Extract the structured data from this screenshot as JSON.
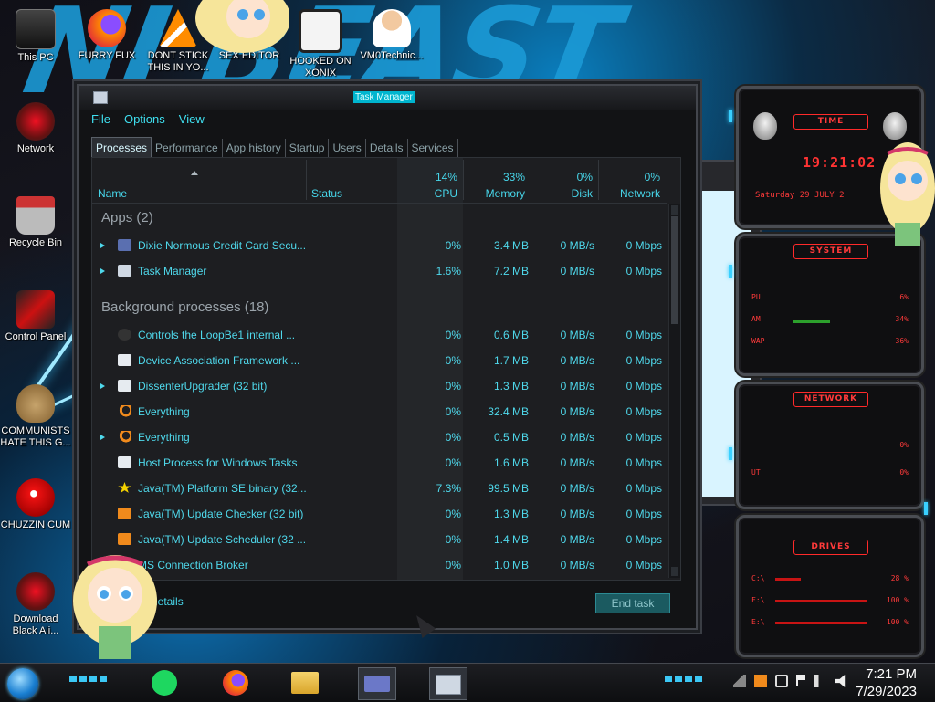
{
  "desktop_icons": [
    {
      "label": "This PC"
    },
    {
      "label": "FURRY FUX"
    },
    {
      "label": "DONT STICK THIS IN YO..."
    },
    {
      "label": "SEX EDITOR"
    },
    {
      "label": "HOOKED ON XONIX"
    },
    {
      "label": "VM0Technic..."
    },
    {
      "label": "Network"
    },
    {
      "label": "Recycle Bin"
    },
    {
      "label": "Control Panel"
    },
    {
      "label": "COMMUNISTS HATE THIS G..."
    },
    {
      "label": "CHUZZIN CUM"
    },
    {
      "label": "Download Black Ali..."
    }
  ],
  "task_manager": {
    "title": "Task Manager",
    "menu": [
      "File",
      "Options",
      "View"
    ],
    "tabs": [
      "Processes",
      "Performance",
      "App history",
      "Startup",
      "Users",
      "Details",
      "Services"
    ],
    "columns": {
      "name": "Name",
      "status": "Status",
      "cpu": {
        "pct": "14%",
        "label": "CPU"
      },
      "memory": {
        "pct": "33%",
        "label": "Memory"
      },
      "disk": {
        "pct": "0%",
        "label": "Disk"
      },
      "network": {
        "pct": "0%",
        "label": "Network"
      }
    },
    "groups": {
      "apps": "Apps (2)",
      "background": "Background processes (18)"
    },
    "apps": [
      {
        "name": "Dixie Normous Credit Card Secu...",
        "cpu": "0%",
        "memory": "3.4 MB",
        "disk": "0 MB/s",
        "network": "0 Mbps"
      },
      {
        "name": "Task Manager",
        "cpu": "1.6%",
        "memory": "7.2 MB",
        "disk": "0 MB/s",
        "network": "0 Mbps"
      }
    ],
    "background": [
      {
        "name": "Controls the LoopBe1 internal ...",
        "cpu": "0%",
        "memory": "0.6 MB",
        "disk": "0 MB/s",
        "network": "0 Mbps"
      },
      {
        "name": "Device Association Framework ...",
        "cpu": "0%",
        "memory": "1.7 MB",
        "disk": "0 MB/s",
        "network": "0 Mbps"
      },
      {
        "name": "DissenterUpgrader (32 bit)",
        "cpu": "0%",
        "memory": "1.3 MB",
        "disk": "0 MB/s",
        "network": "0 Mbps"
      },
      {
        "name": "Everything",
        "cpu": "0%",
        "memory": "32.4 MB",
        "disk": "0 MB/s",
        "network": "0 Mbps"
      },
      {
        "name": "Everything",
        "cpu": "0%",
        "memory": "0.5 MB",
        "disk": "0 MB/s",
        "network": "0 Mbps"
      },
      {
        "name": "Host Process for Windows Tasks",
        "cpu": "0%",
        "memory": "1.6 MB",
        "disk": "0 MB/s",
        "network": "0 Mbps"
      },
      {
        "name": "Java(TM) Platform SE binary (32...",
        "cpu": "7.3%",
        "memory": "99.5 MB",
        "disk": "0 MB/s",
        "network": "0 Mbps"
      },
      {
        "name": "Java(TM) Update Checker (32 bit)",
        "cpu": "0%",
        "memory": "1.3 MB",
        "disk": "0 MB/s",
        "network": "0 Mbps"
      },
      {
        "name": "Java(TM) Update Scheduler (32 ...",
        "cpu": "0%",
        "memory": "1.4 MB",
        "disk": "0 MB/s",
        "network": "0 Mbps"
      },
      {
        "name": "MS Connection Broker",
        "cpu": "0%",
        "memory": "1.0 MB",
        "disk": "0 MB/s",
        "network": "0 Mbps"
      }
    ],
    "fewer_details": "details",
    "end_task": "End task"
  },
  "gadget": {
    "time_title": "TIME",
    "time": "19:21:02",
    "date": "Saturday 29 JULY 2",
    "system_title": "SYSTEM",
    "system": [
      {
        "label": "PU",
        "value": "6%"
      },
      {
        "label": "AM",
        "value": "34%"
      },
      {
        "label": "WAP",
        "value": "36%"
      }
    ],
    "network_title": "NETWORK",
    "network": [
      {
        "label": "",
        "value": "0%"
      },
      {
        "label": "UT",
        "value": "0%"
      }
    ],
    "drives_title": "DRIVES",
    "drives": [
      {
        "label": "C:\\",
        "value": "28 %",
        "fill": 0.28
      },
      {
        "label": "F:\\",
        "value": "100 %",
        "fill": 1.0
      },
      {
        "label": "E:\\",
        "value": "100 %",
        "fill": 1.0
      }
    ]
  },
  "clock": {
    "time": "7:21 PM",
    "date": "7/29/2023"
  }
}
